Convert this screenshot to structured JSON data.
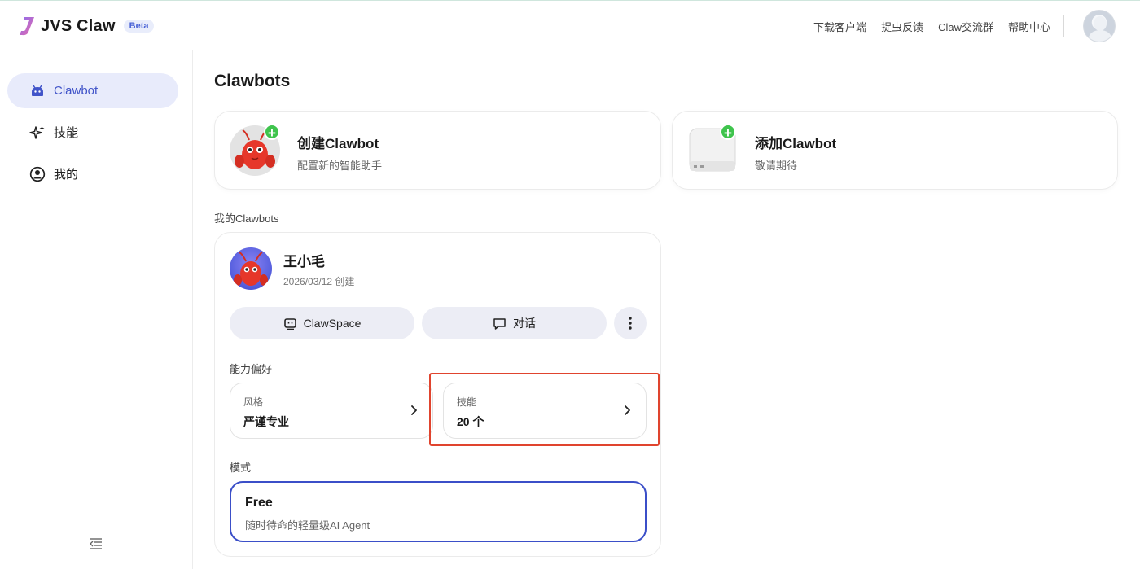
{
  "header": {
    "app_name": "JVS Claw",
    "badge": "Beta",
    "nav": [
      "下载客户端",
      "捉虫反馈",
      "Claw交流群",
      "帮助中心"
    ]
  },
  "sidebar": {
    "items": [
      {
        "label": "Clawbot",
        "icon": "android-robot-icon",
        "active": true
      },
      {
        "label": "技能",
        "icon": "sparkle-icon",
        "active": false
      },
      {
        "label": "我的",
        "icon": "user-circle-icon",
        "active": false
      }
    ],
    "collapse_icon": "collapse-menu-icon"
  },
  "main": {
    "title": "Clawbots",
    "create_cards": [
      {
        "title": "创建Clawbot",
        "subtitle": "配置新的智能助手",
        "icon": "red-lobster-mascot"
      },
      {
        "title": "添加Clawbot",
        "subtitle": "敬请期待",
        "icon": "white-device-box"
      }
    ],
    "my_label": "我的Clawbots",
    "bot": {
      "name": "王小毛",
      "created": "2026/03/12 创建",
      "actions": {
        "clawspace": "ClawSpace",
        "chat": "对话"
      },
      "pref_label": "能力偏好",
      "prefs": [
        {
          "key": "风格",
          "value": "严谨专业"
        },
        {
          "key": "技能",
          "value": "20 个"
        }
      ],
      "mode_label": "模式",
      "mode": {
        "name": "Free",
        "desc": "随时待命的轻量级AI Agent"
      }
    }
  },
  "colors": {
    "accent": "#4154c9",
    "highlight": "#e0442e",
    "plus_green": "#3fc44d"
  }
}
